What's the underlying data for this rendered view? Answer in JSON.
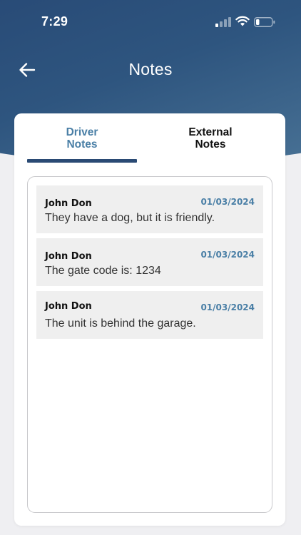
{
  "status_bar": {
    "time": "7:29",
    "icons": [
      "signal-icon",
      "wifi-icon",
      "battery-icon"
    ]
  },
  "nav": {
    "back_icon": "arrow-left-icon",
    "title": "Notes"
  },
  "tabs": [
    {
      "label_line1": "Driver",
      "label_line2": "Notes",
      "active": true
    },
    {
      "label_line1": "External",
      "label_line2": "Notes",
      "active": false
    }
  ],
  "notes": [
    {
      "author": "John Don",
      "date": "01/03/2024",
      "text": "They have a dog, but it is friendly."
    },
    {
      "author": "John Don",
      "date": "01/03/2024",
      "text": "The gate code is: 1234"
    },
    {
      "author": "John Don",
      "date": "01/03/2024",
      "text": "The unit is behind the garage."
    }
  ],
  "colors": {
    "header_dark": "#284a76",
    "header_light": "#4a7396",
    "accent": "#4a7fa6",
    "indicator": "#2a4a74",
    "note_bg": "#efefef"
  }
}
